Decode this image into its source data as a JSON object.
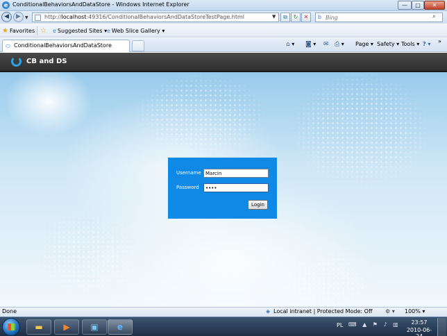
{
  "window": {
    "title": "ConditionalBehaviorsAndDataStore - Windows Internet Explorer",
    "minimize_glyph": "—",
    "maximize_glyph": "□",
    "close_glyph": "✕"
  },
  "nav": {
    "url_prefix": "http://",
    "url_host": "localhost",
    "url_rest": ":49316/ConditionalBehaviorsAndDataStoreTestPage.html",
    "search_placeholder": "Bing"
  },
  "favorites_bar": {
    "favorites_label": "Favorites",
    "suggested_sites_label": "Suggested Sites ▾",
    "web_slice_label": "Web Slice Gallery ▾"
  },
  "tabs": [
    {
      "label": "ConditionalBehaviorsAndDataStore"
    }
  ],
  "commands": {
    "page_label": "Page ▾",
    "safety_label": "Safety ▾",
    "tools_label": "Tools ▾",
    "help_glyph": "? ▾",
    "overflow_glyph": "»"
  },
  "site": {
    "title": "CB and DS"
  },
  "login": {
    "username_label": "Username",
    "username_value": "Marcin",
    "password_label": "Password",
    "password_value": "abcd",
    "button_label": "Login"
  },
  "status": {
    "text": "Done",
    "zone": "Local intranet | Protected Mode: Off",
    "zoom": "100%  ▾"
  },
  "taskbar": {
    "language": "PL",
    "time": "23:57",
    "date": "2010-06-24"
  },
  "colors": {
    "login_panel": "#0e8ae6",
    "site_header": "#3a3a3a",
    "logo_accent": "#2ba3ea"
  }
}
